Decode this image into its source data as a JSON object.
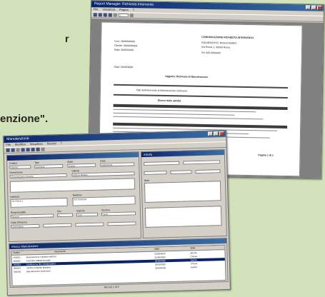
{
  "background": {
    "text_line1": "r",
    "text_line2": "enzione\"."
  },
  "report_window": {
    "title": "Report Manager: Richiesta Intervento",
    "menu": [
      "File",
      "Visualizza",
      "Pagina",
      "?"
    ],
    "toolbar_field": "1",
    "doc": {
      "header_left": [
        "Cod.: 0000000000",
        "Cliente: 0000000000",
        "Data: 00/00/0000"
      ],
      "header_right": [
        "COMUNICAZIONE RICHIESTA INTERVENTO",
        "RICHIEDENTE: ROSSI MARIO",
        "Via Roma 1, 00000 Roma",
        "Tel. 000 0000000"
      ],
      "date_line": "Data: 00/00/0000",
      "oggetto": "Oggetto: Richiesta di Manutenzione",
      "section1": "Dati dell'intervento di Manutenzione Ordinaria",
      "section2": "Elenco delle attività",
      "footer": "Pagina 1 di 1"
    }
  },
  "form_window": {
    "title": "Manutenzione",
    "menu": [
      "File",
      "Modifica",
      "Visualizza",
      "Record",
      "?"
    ],
    "labels": {
      "codice": "Codice",
      "tipo": "Tipo",
      "stato": "Stato",
      "descrizione": "Descrizione",
      "data": "Data",
      "cliente": "Cliente",
      "indirizzo": "Indirizzo",
      "telefono": "Telefono",
      "note": "Note",
      "responsabile": "Responsabile",
      "ore": "Ore",
      "importo": "Importo",
      "tecnico": "Tecnico",
      "chiusura": "Data Chiusura"
    },
    "values": {
      "codice": "000001",
      "tipo": "Ordinaria",
      "stato": "Aperta",
      "descrizione": "Manutenzione impianto",
      "data": "00/00/0000",
      "cliente": "ROSSI MARIO",
      "indirizzo": "Via Roma 1",
      "telefono": "000 0000000",
      "responsabile": "Bianchi",
      "ore": "2",
      "importo": "0,00",
      "tecnico": "Verdi",
      "chiusura": "00/00/0000"
    },
    "side_title": "Attività",
    "grid_title": "Elenco Manutenzioni",
    "grid": {
      "columns": [
        "Codice",
        "Descrizione",
        "Data",
        "Stato"
      ],
      "rows": [
        [
          "000001",
          "Manutenzione impianto elettrico",
          "00/00/0000",
          "Aperta"
        ],
        [
          "000002",
          "Controllo caldaia annuale",
          "00/00/0000",
          "Chiusa"
        ],
        [
          "000003",
          "Sostituzione filtri climatizzatore",
          "00/00/0000",
          "Aperta"
        ],
        [
          "000004",
          "Verifica impianto idraulico",
          "00/00/0000",
          "Chiusa"
        ],
        [
          "000005",
          "Manutenzione ascensore",
          "00/00/0000",
          "Aperta"
        ]
      ]
    },
    "status_text": "Record 1 di 5"
  }
}
